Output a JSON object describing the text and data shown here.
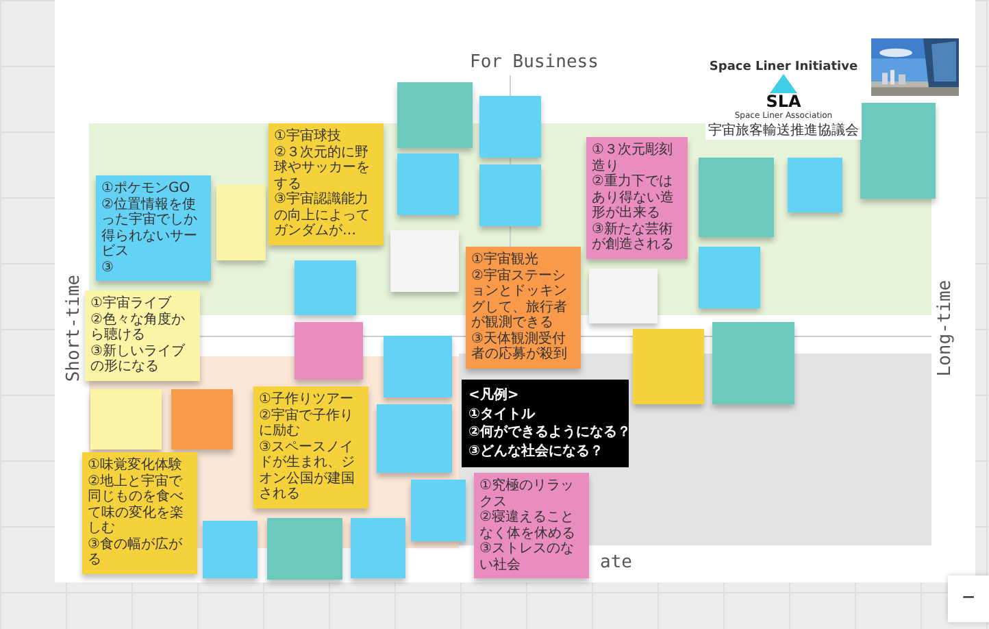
{
  "board": {
    "top_label": "For Business",
    "left_label": "Short-time",
    "right_label": "Long-time",
    "bottom_label": "ate"
  },
  "logo": {
    "title": "Space Liner Initiative",
    "mark": "SLA",
    "org_en": "Space Liner Association",
    "org_ja": "宇宙旅客輸送推進協議会"
  },
  "sticky_notes": [
    {
      "color": "#fbf3a6"
    },
    {
      "color": "#63d2f5"
    },
    {
      "color": "#6cc9be"
    },
    {
      "color": "#63d2f5"
    },
    {
      "color": "#63d2f5"
    },
    {
      "color": "#63d2f5"
    },
    {
      "color": "#f4f4f4"
    },
    {
      "color": "#f4f4f4"
    },
    {
      "color": "#6cc9be"
    },
    {
      "color": "#63d2f5"
    },
    {
      "color": "#6cc9be"
    },
    {
      "color": "#63d2f5"
    },
    {
      "color": "#6cc9be"
    },
    {
      "color": "#63d2f5"
    },
    {
      "color": "#e98cc0"
    },
    {
      "color": "#f5d13b"
    },
    {
      "color": "#fbf3a6"
    },
    {
      "color": "#f99a4a"
    },
    {
      "color": "#63d2f5"
    },
    {
      "color": "#63d2f5"
    },
    {
      "color": "#6cc9be"
    },
    {
      "color": "#63d2f5"
    },
    {
      "color": "#63d2f5"
    },
    {
      "color": "#63d2f5",
      "text": "①ポケモンGO\n②位置情報を使った宇宙でしか得られないサービス\n③"
    },
    {
      "color": "#fbf3a6",
      "text": "①宇宙ライブ\n②色々な角度から聴ける\n③新しいライブの形になる"
    },
    {
      "color": "#f5d13b",
      "text": "①宇宙球技\n②３次元的に野球やサッカーをする\n③宇宙認識能力の向上によってガンダムが…"
    },
    {
      "color": "#e98cc0",
      "text": "①３次元彫刻造り\n②重力下ではあり得ない造形が出来る\n③新たな芸術が創造される"
    },
    {
      "color": "#f5d13b",
      "text": "①子作りツアー\n②宇宙で子作りに励む\n③スペースノイドが生まれ、ジオン公国が建国される"
    },
    {
      "color": "#f5d13b",
      "text": "①味覚変化体験\n②地上と宇宙で同じものを食べて味の変化を楽しむ\n③食の幅が広がる"
    },
    {
      "color": "#f99a4a",
      "text": "①宇宙観光\n②宇宙ステーションとドッキングして、旅行者が観測できる\n③天体観測受付者の応募が殺到"
    },
    {
      "color": "#e98cc0",
      "text": "①究極のリラックス\n②寝違えることなく体を休める\n③ストレスのない社会"
    }
  ],
  "legend": [
    "<凡例>",
    "①タイトル",
    "②何ができるようになる？",
    "③どんな社会になる？"
  ],
  "zoom_control": {
    "label": "−"
  }
}
